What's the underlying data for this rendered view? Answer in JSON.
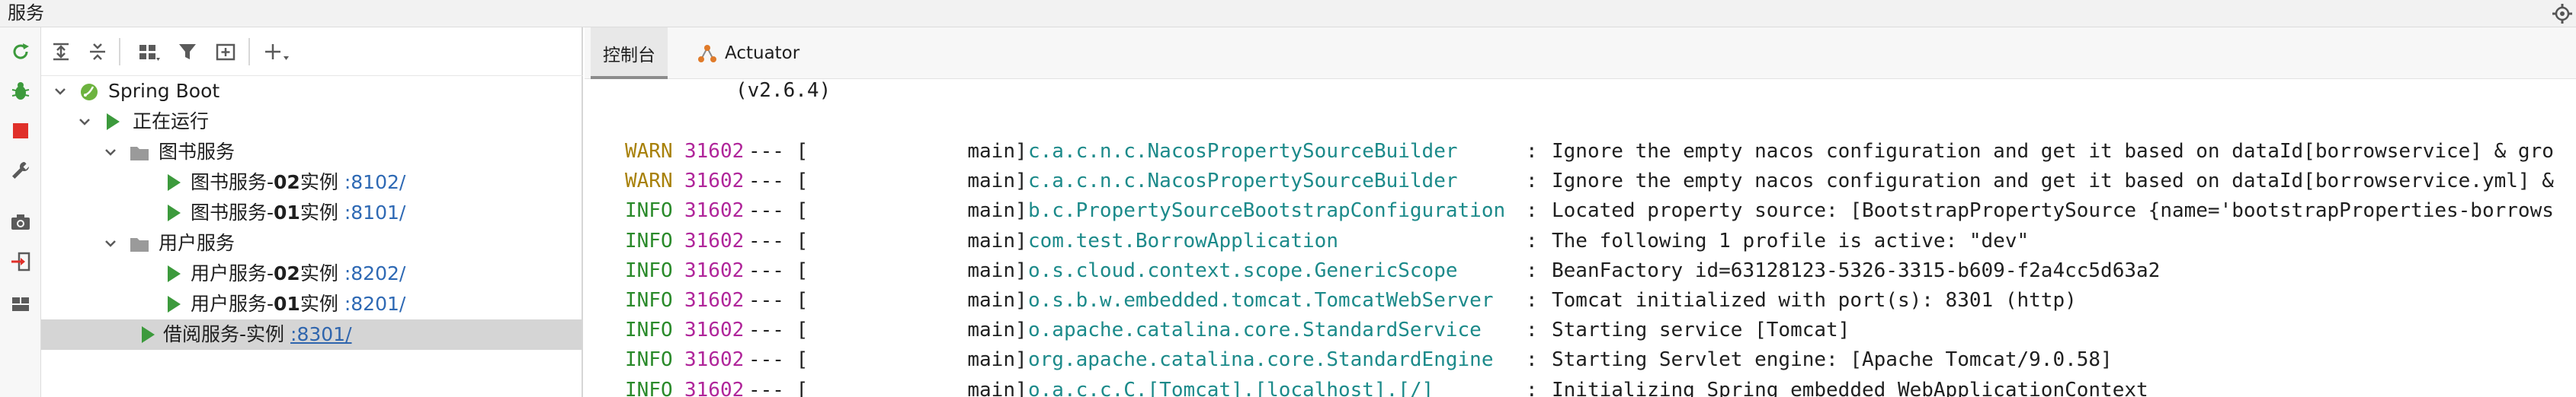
{
  "header": {
    "title": "服务"
  },
  "tree": {
    "root": {
      "label": "Spring Boot"
    },
    "running_group": {
      "label": "正在运行"
    },
    "groups": [
      {
        "label": "图书服务",
        "instances": [
          {
            "name_prefix": "图书服务-",
            "name_bold": "02",
            "name_suffix": "实例",
            "port": ":8102/"
          },
          {
            "name_prefix": "图书服务-",
            "name_bold": "01",
            "name_suffix": "实例",
            "port": ":8101/"
          }
        ]
      },
      {
        "label": "用户服务",
        "instances": [
          {
            "name_prefix": "用户服务-",
            "name_bold": "02",
            "name_suffix": "实例",
            "port": ":8202/"
          },
          {
            "name_prefix": "用户服务-",
            "name_bold": "01",
            "name_suffix": "实例",
            "port": ":8201/"
          }
        ]
      }
    ],
    "selected_instance": {
      "name": "借阅服务-实例",
      "port": ":8301/"
    }
  },
  "tabs": [
    {
      "label": "控制台",
      "active": true
    },
    {
      "label": "Actuator",
      "active": false
    }
  ],
  "console": {
    "version": "(v2.6.4)",
    "lines": [
      {
        "level": "WARN",
        "pid": "31602",
        "sep": "--- [",
        "thread": "main",
        "logger": "c.a.c.n.c.NacosPropertySourceBuilder",
        "message": "Ignore the empty nacos configuration and get it based on dataId[borrowservice] & gro"
      },
      {
        "level": "WARN",
        "pid": "31602",
        "sep": "--- [",
        "thread": "main",
        "logger": "c.a.c.n.c.NacosPropertySourceBuilder",
        "message": "Ignore the empty nacos configuration and get it based on dataId[borrowservice.yml] &"
      },
      {
        "level": "INFO",
        "pid": "31602",
        "sep": "--- [",
        "thread": "main",
        "logger": "b.c.PropertySourceBootstrapConfiguration",
        "message": "Located property source: [BootstrapPropertySource {name='bootstrapProperties-borrows"
      },
      {
        "level": "INFO",
        "pid": "31602",
        "sep": "--- [",
        "thread": "main",
        "logger": "com.test.BorrowApplication",
        "message": "The following 1 profile is active: \"dev\""
      },
      {
        "level": "INFO",
        "pid": "31602",
        "sep": "--- [",
        "thread": "main",
        "logger": "o.s.cloud.context.scope.GenericScope",
        "message": "BeanFactory id=63128123-5326-3315-b609-f2a4cc5d63a2"
      },
      {
        "level": "INFO",
        "pid": "31602",
        "sep": "--- [",
        "thread": "main",
        "logger": "o.s.b.w.embedded.tomcat.TomcatWebServer",
        "message": "Tomcat initialized with port(s): 8301 (http)"
      },
      {
        "level": "INFO",
        "pid": "31602",
        "sep": "--- [",
        "thread": "main",
        "logger": "o.apache.catalina.core.StandardService",
        "message": "Starting service [Tomcat]"
      },
      {
        "level": "INFO",
        "pid": "31602",
        "sep": "--- [",
        "thread": "main",
        "logger": "org.apache.catalina.core.StandardEngine",
        "message": "Starting Servlet engine: [Apache Tomcat/9.0.58]"
      },
      {
        "level": "INFO",
        "pid": "31602",
        "sep": "--- [",
        "thread": "main",
        "logger": "o.a.c.c.C.[Tomcat].[localhost].[/]",
        "message": "Initializing Spring embedded WebApplicationContext"
      }
    ]
  },
  "colors": {
    "warn": "#a8810a",
    "info": "#2a8a2a",
    "pid": "#b0259a",
    "logger": "#1c8a8a",
    "port": "#2e69b4",
    "run": "#3c9a3c",
    "stop": "#e0302a"
  },
  "icons": {
    "title_bar": [
      "settings-icon"
    ],
    "left_toolbar": [
      "rerun-icon",
      "debug-bug-icon",
      "stop-icon",
      "wrench-icon",
      "camera-icon",
      "attach-login-icon",
      "layout-icon"
    ],
    "tree_toolbar": [
      "expand-all-icon",
      "collapse-all-icon",
      "group-icon",
      "filter-icon",
      "new-service-icon",
      "add-icon"
    ]
  }
}
